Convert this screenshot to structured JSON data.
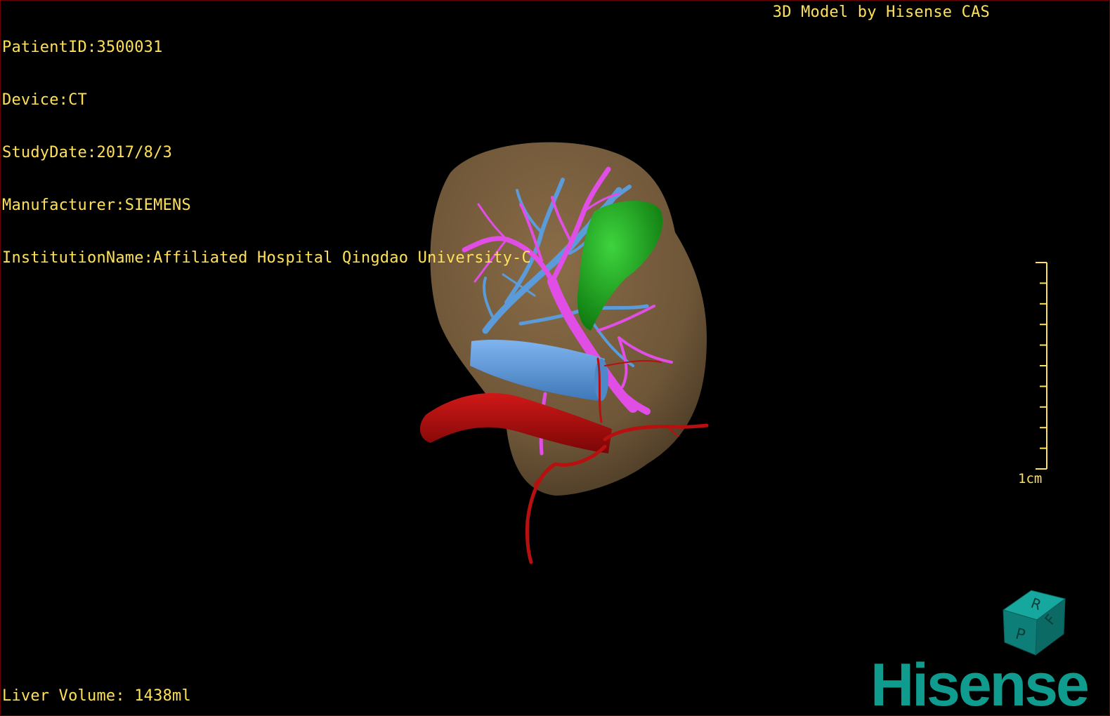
{
  "patient": {
    "id_line": "PatientID:3500031",
    "device_line": "Device:CT",
    "study_date_line": "StudyDate:2017/8/3",
    "manufacturer_line": "Manufacturer:SIEMENS",
    "institution_line": "InstitutionName:Affiliated Hospital Qingdao University-C"
  },
  "header": {
    "brand_text": "3D Model by Hisense CAS"
  },
  "footer": {
    "liver_volume": "Liver Volume: 1438ml"
  },
  "scale": {
    "label": "1cm",
    "ticks": 10
  },
  "orientation_cube": {
    "labels": [
      "R",
      "F",
      "P"
    ],
    "color": "#0e7f78"
  },
  "logo": {
    "text": "Hisense",
    "color": "#0f9b8e"
  },
  "colors": {
    "text": "#ffe05a",
    "liver": "#6e5638",
    "portal_vein": "#e14ee6",
    "hepatic_vein": "#5b9bd9",
    "artery": "#b80f0f",
    "gallbladder": "#20b020"
  }
}
